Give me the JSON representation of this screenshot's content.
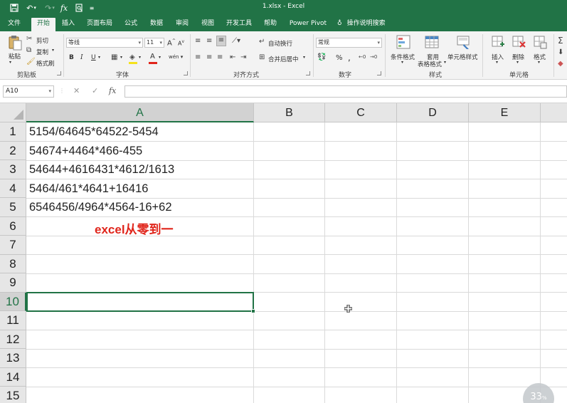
{
  "window": {
    "title": "1.xlsx  -  Excel"
  },
  "tabs": [
    "文件",
    "开始",
    "插入",
    "页面布局",
    "公式",
    "数据",
    "审阅",
    "视图",
    "开发工具",
    "帮助",
    "Power Pivot"
  ],
  "active_tab": "开始",
  "tell_me": "操作说明搜索",
  "ribbon": {
    "clipboard": {
      "label": "剪贴板",
      "paste": "粘贴",
      "cut": "剪切",
      "copy": "复制",
      "format_painter": "格式刷"
    },
    "font": {
      "label": "字体",
      "font_name": "等线",
      "font_size": "11",
      "bold": "B",
      "italic": "I",
      "underline": "U",
      "font_color": "A",
      "highlight": "A",
      "grow": "A",
      "shrink": "A",
      "phonetic": "wén"
    },
    "alignment": {
      "label": "对齐方式",
      "wrap": "自动换行",
      "merge": "合并后居中"
    },
    "number": {
      "label": "数字",
      "format": "常规",
      "percent": "%",
      "comma": ","
    },
    "styles": {
      "label": "样式",
      "conditional": "条件格式",
      "table1": "套用",
      "table2": "表格格式",
      "cell_styles": "单元格样式"
    },
    "cells": {
      "label": "单元格",
      "insert": "插入",
      "delete": "删除",
      "format": "格式"
    }
  },
  "formula_bar": {
    "name_box": "A10",
    "cancel": "✕",
    "enter": "✓",
    "fx": "fx",
    "value": ""
  },
  "columns": [
    "A",
    "B",
    "C",
    "D",
    "E"
  ],
  "selected_column": "A",
  "rows": [
    "1",
    "2",
    "3",
    "4",
    "5",
    "6",
    "7",
    "8",
    "9",
    "10",
    "11",
    "12",
    "13",
    "14",
    "15"
  ],
  "selected_row": "10",
  "cells": {
    "A1": "5154/64645*64522-5454",
    "A2": "54674+4464*466-455",
    "A3": "54644+4616431*4612/1613",
    "A4": "5464/461*4641+16416",
    "A5": "6546456/4964*4564-16+62",
    "A6": "excel从零到一"
  },
  "overlay_badge": {
    "value": "33",
    "unit": "%"
  },
  "colors": {
    "excel_green": "#217346",
    "annotation_red": "#e0251b"
  }
}
